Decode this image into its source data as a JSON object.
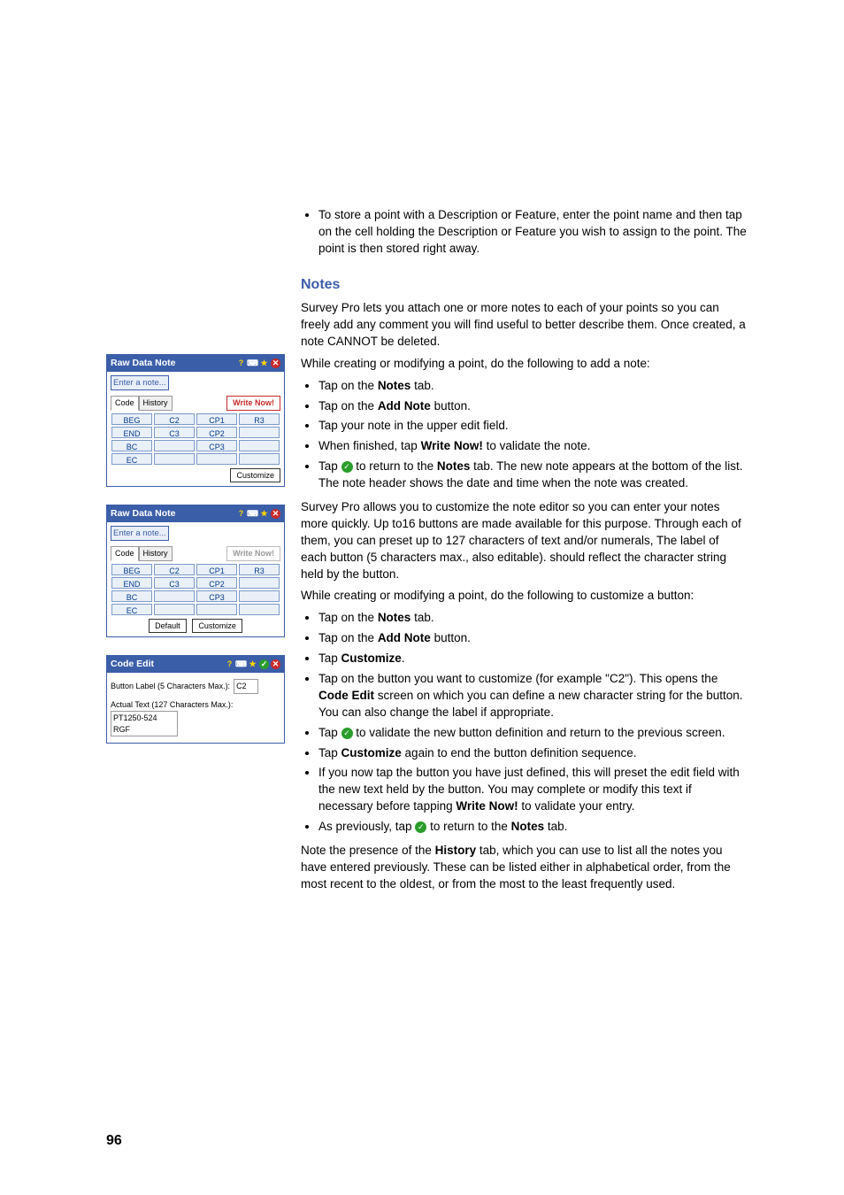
{
  "intro_bullet": "To store a point with a Description or Feature, enter the point name and then tap on the cell holding the Description or Feature you wish to assign to the point. The point is then stored right away.",
  "heading": "Notes",
  "para1": "Survey Pro lets you attach one or more notes to each of your points so you can freely add any comment you will find useful to better describe them. Once created, a note CANNOT be deleted.",
  "para2": "While creating or modifying a point, do the following to add a note:",
  "list1": {
    "i0_a": "Tap on the ",
    "i0_b": "Notes",
    "i0_c": " tab.",
    "i1_a": "Tap on the ",
    "i1_b": "Add Note",
    "i1_c": " button.",
    "i2": "Tap your note in the upper edit field.",
    "i3_a": "When finished, tap ",
    "i3_b": "Write Now!",
    "i3_c": " to validate the note.",
    "i4_a": "Tap ",
    "i4_b": " to return to the ",
    "i4_c": "Notes",
    "i4_d": " tab. The new note appears at the bottom of the list. The note header shows the date and time when the note was created."
  },
  "para3": "Survey Pro allows you to customize the note editor so you can enter your notes more quickly. Up to16 buttons are made available for this purpose. Through each of them, you can preset up to 127 characters of text and/or numerals, The label of each button (5 characters max., also editable). should reflect the character string held by the button.",
  "para4": "While creating or modifying a point, do the following to customize a button:",
  "list2": {
    "i0_a": "Tap on the ",
    "i0_b": "Notes",
    "i0_c": " tab.",
    "i1_a": "Tap on the ",
    "i1_b": "Add Note",
    "i1_c": " button.",
    "i2_a": "Tap ",
    "i2_b": "Customize",
    "i2_c": ".",
    "i3_a": "Tap on the button you want to customize (for example \"C2\"). This opens the ",
    "i3_b": "Code Edit",
    "i3_c": " screen on which you can define a new character string for the button. You can also change the label if appropriate.",
    "i4_a": "Tap ",
    "i4_b": " to validate the new button definition and return to the previous screen.",
    "i5_a": "Tap ",
    "i5_b": "Customize",
    "i5_c": " again to end the button definition sequence.",
    "i6_a": "If you now tap the button you have just defined, this will preset the edit field with the new text held by the button. You may complete or modify this text if necessary before tapping ",
    "i6_b": "Write Now!",
    "i6_c": " to validate your entry.",
    "i7_a": "As previously, tap ",
    "i7_b": " to return to the ",
    "i7_c": "Notes",
    "i7_d": " tab."
  },
  "para5_a": "Note the presence of the ",
  "para5_b": "History",
  "para5_c": " tab, which you can use to list all the notes you have entered previously. These can be listed either in alphabetical order, from the most recent to the oldest, or from the most to the least frequently used.",
  "page_number": "96",
  "panel1": {
    "title": "Raw Data Note",
    "placeholder": "Enter a note...",
    "tab_code": "Code",
    "tab_history": "History",
    "write_now": "Write Now!",
    "grid": [
      [
        "BEG",
        "C2",
        "CP1",
        "R3"
      ],
      [
        "END",
        "C3",
        "CP2",
        ""
      ],
      [
        "BC",
        "",
        "CP3",
        ""
      ],
      [
        "EC",
        "",
        "",
        ""
      ]
    ],
    "customize": "Customize"
  },
  "panel2": {
    "title": "Raw Data Note",
    "placeholder": "Enter a note...",
    "tab_code": "Code",
    "tab_history": "History",
    "write_now": "Write Now!",
    "grid": [
      [
        "BEG",
        "C2",
        "CP1",
        "R3"
      ],
      [
        "END",
        "C3",
        "CP2",
        ""
      ],
      [
        "BC",
        "",
        "CP3",
        ""
      ],
      [
        "EC",
        "",
        "",
        ""
      ]
    ],
    "default": "Default",
    "customize": "Customize"
  },
  "panel3": {
    "title": "Code Edit",
    "label_text": "Button Label (5 Characters Max.):",
    "label_value": "C2",
    "actual_label": "Actual Text (127 Characters Max.):",
    "actual_value": "PT1250-524 RGF"
  }
}
